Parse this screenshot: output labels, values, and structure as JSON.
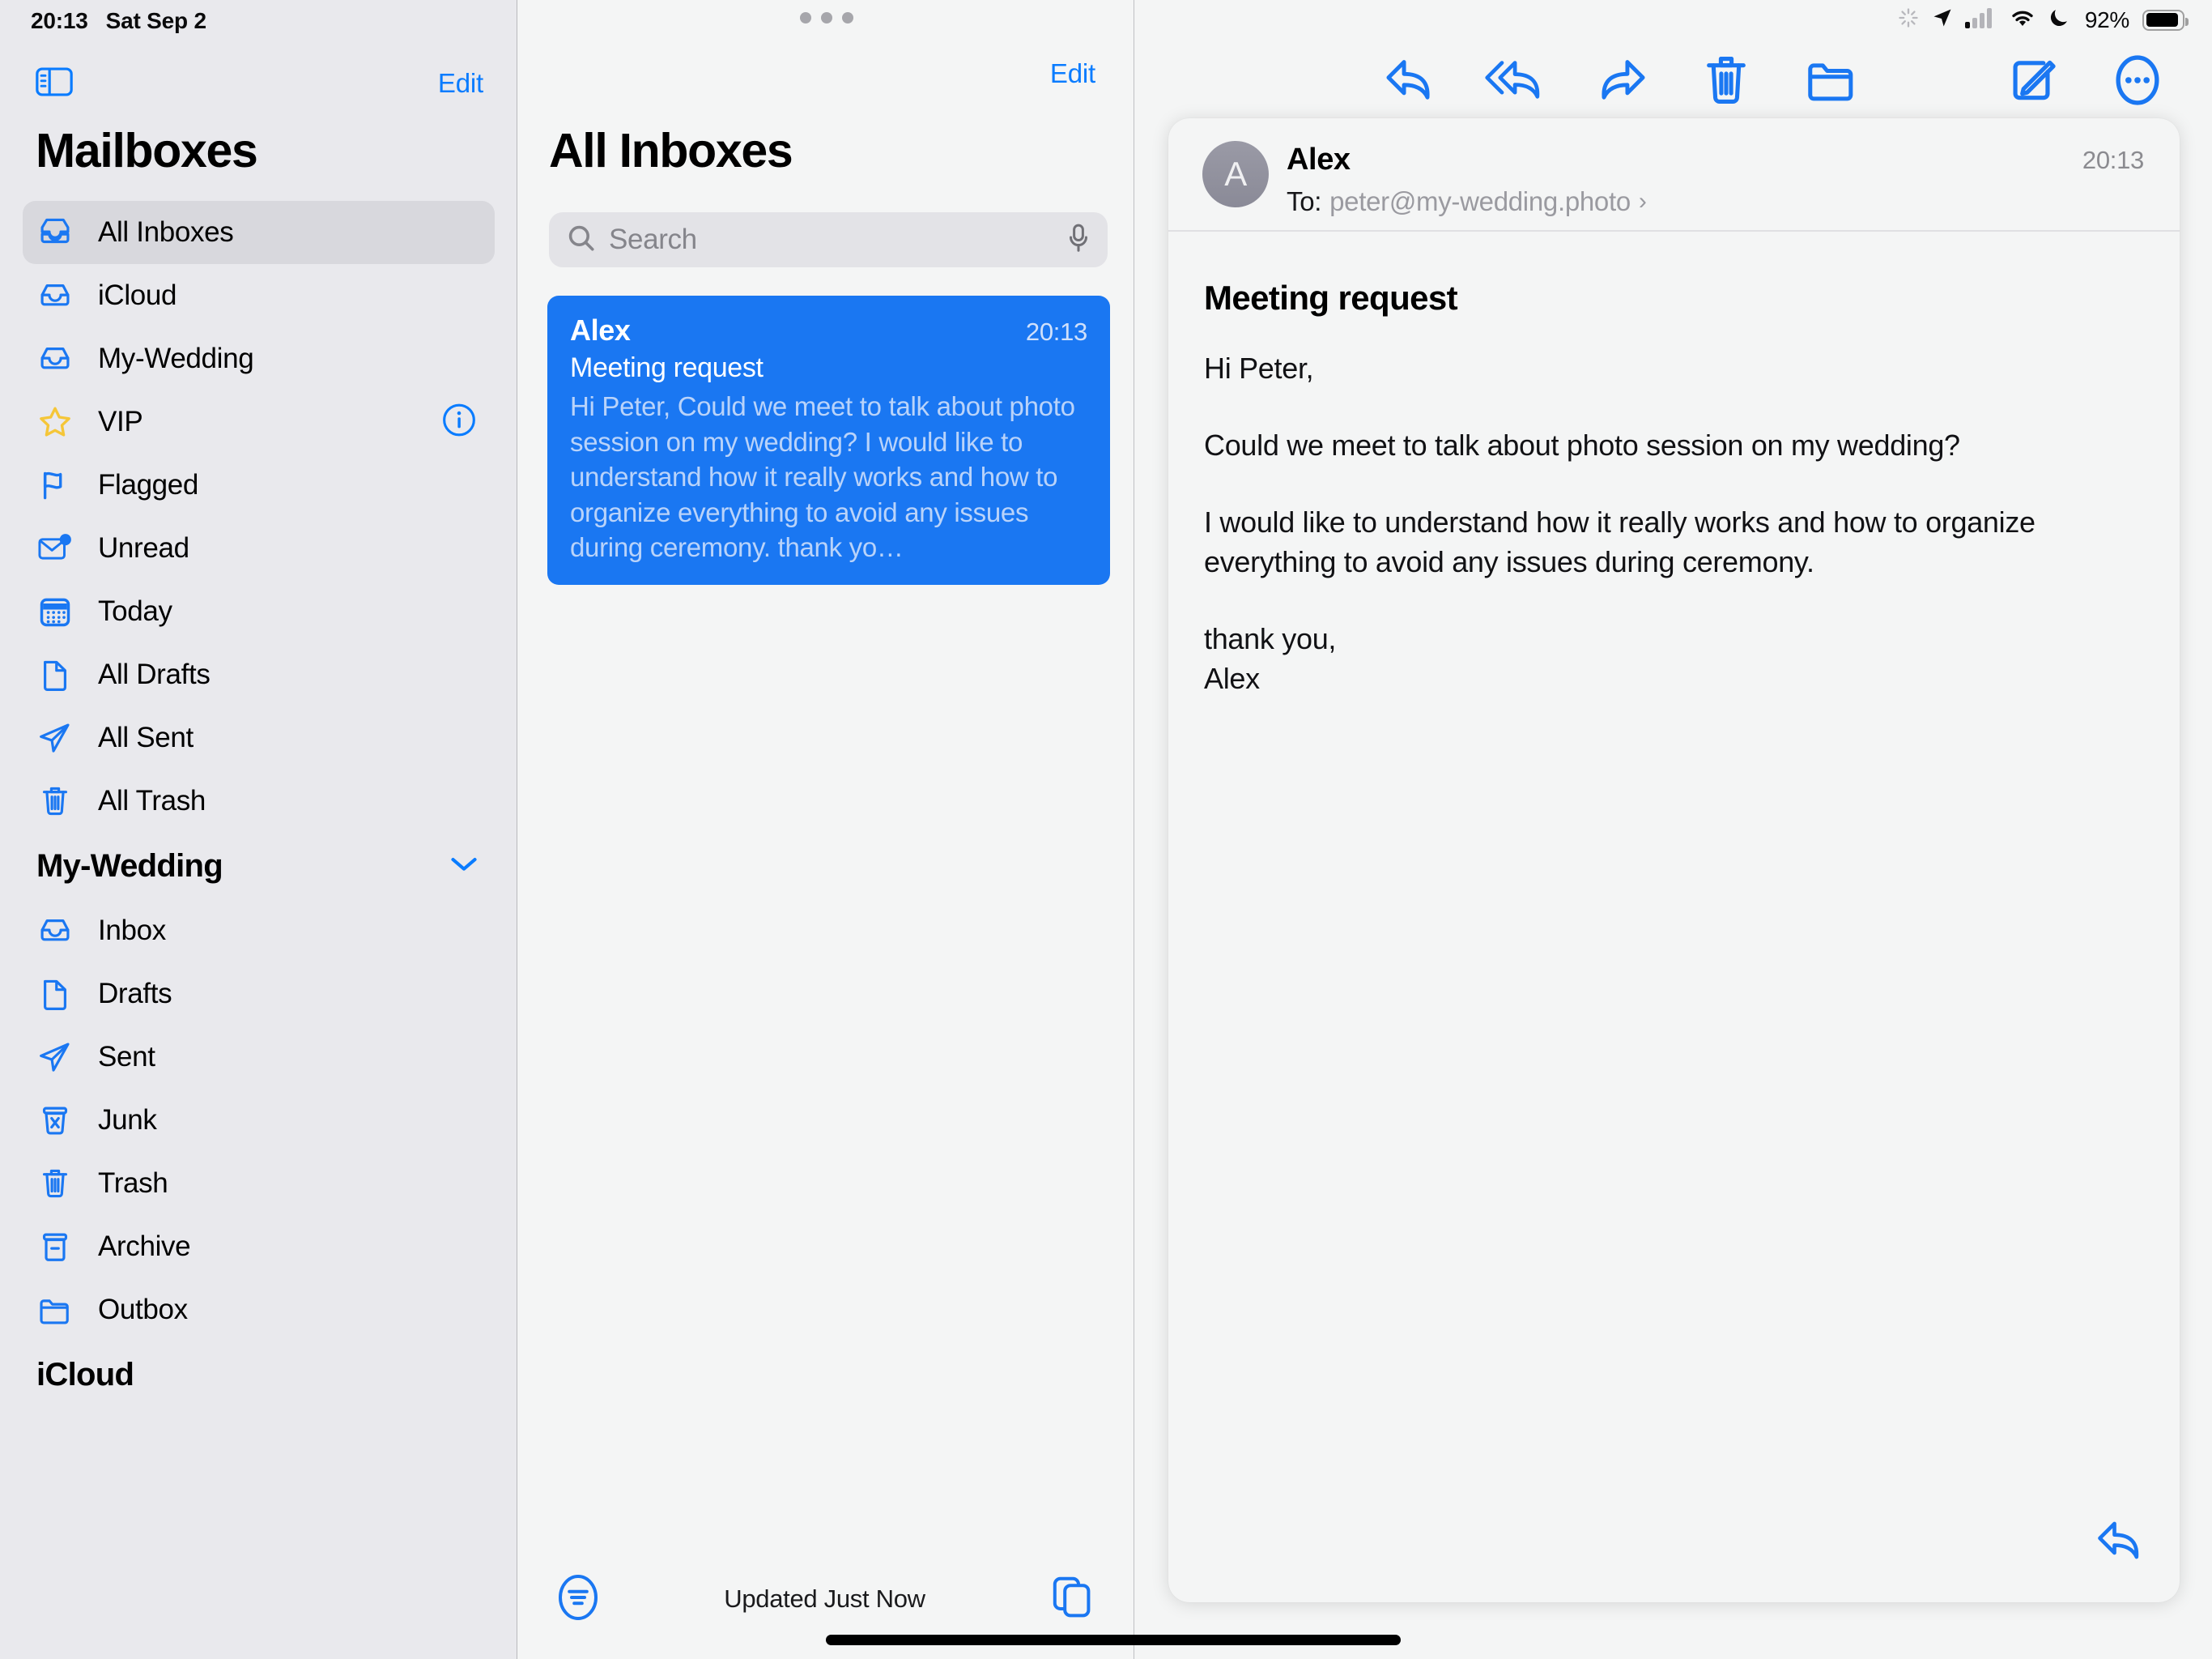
{
  "statusbar": {
    "time": "20:13",
    "date": "Sat Sep 2",
    "battery_percent": "92%",
    "icons": [
      "activity-spinner-icon",
      "location-arrow-icon",
      "cellular-signal-icon",
      "wifi-icon",
      "moon-do-not-disturb-icon",
      "battery-icon"
    ]
  },
  "sidebar": {
    "toggle_icon": "sidebar-toggle-icon",
    "edit_label": "Edit",
    "title": "Mailboxes",
    "items": [
      {
        "label": "All Inboxes",
        "icon": "inbox-stack-icon",
        "selected": true
      },
      {
        "label": "iCloud",
        "icon": "inbox-icon",
        "selected": false
      },
      {
        "label": "My-Wedding",
        "icon": "inbox-icon",
        "selected": false
      },
      {
        "label": "VIP",
        "icon": "star-icon",
        "selected": false,
        "trailing_icon": "info-circle-icon"
      },
      {
        "label": "Flagged",
        "icon": "flag-icon",
        "selected": false
      },
      {
        "label": "Unread",
        "icon": "unread-envelope-icon",
        "selected": false
      },
      {
        "label": "Today",
        "icon": "calendar-icon",
        "selected": false
      },
      {
        "label": "All Drafts",
        "icon": "document-icon",
        "selected": false
      },
      {
        "label": "All Sent",
        "icon": "paper-plane-icon",
        "selected": false
      },
      {
        "label": "All Trash",
        "icon": "trash-icon",
        "selected": false
      }
    ],
    "sections": [
      {
        "title": "My-Wedding",
        "chevron_icon": "chevron-down-icon",
        "items": [
          {
            "label": "Inbox",
            "icon": "inbox-icon"
          },
          {
            "label": "Drafts",
            "icon": "document-icon"
          },
          {
            "label": "Sent",
            "icon": "paper-plane-icon"
          },
          {
            "label": "Junk",
            "icon": "junk-bin-icon"
          },
          {
            "label": "Trash",
            "icon": "trash-icon"
          },
          {
            "label": "Archive",
            "icon": "archive-box-icon"
          },
          {
            "label": "Outbox",
            "icon": "folder-icon"
          }
        ]
      },
      {
        "title": "iCloud",
        "chevron_icon": "chevron-down-icon",
        "items": []
      }
    ]
  },
  "list_pane": {
    "edit_label": "Edit",
    "title": "All Inboxes",
    "search": {
      "placeholder": "Search",
      "icon": "search-icon",
      "mic_icon": "microphone-icon"
    },
    "messages": [
      {
        "sender": "Alex",
        "time": "20:13",
        "subject": "Meeting request",
        "preview": "Hi Peter, Could we meet to talk about photo session on my wedding? I would like to understand how it really works and how to organize everything to avoid any issues during ceremony. thank yo…",
        "selected": true
      }
    ],
    "bottom": {
      "filter_icon": "filter-lines-circle-icon",
      "status": "Updated Just Now",
      "compose_pages_icon": "duplicate-pages-icon"
    }
  },
  "detail_pane": {
    "toolbar": [
      {
        "name": "reply-button",
        "icon": "reply-arrow-icon"
      },
      {
        "name": "reply-all-button",
        "icon": "reply-all-arrow-icon"
      },
      {
        "name": "forward-button",
        "icon": "forward-arrow-icon"
      },
      {
        "name": "delete-button",
        "icon": "trash-icon"
      },
      {
        "name": "move-to-folder-button",
        "icon": "folder-icon"
      },
      {
        "name": "compose-button",
        "icon": "compose-pencil-icon"
      },
      {
        "name": "more-actions-button",
        "icon": "ellipsis-circle-icon"
      }
    ],
    "message": {
      "avatar_initial": "A",
      "sender": "Alex",
      "time": "20:13",
      "to_label": "To:",
      "to_address": "peter@my-wedding.photo",
      "to_chevron": "›",
      "subject": "Meeting request",
      "body_paragraphs": [
        "Hi Peter,",
        "Could we meet to talk about photo session on my wedding?",
        "I would like to understand how it really works and how to organize everything to avoid any issues during ceremony."
      ],
      "signature": "thank you,\nAlex"
    },
    "reply_icon": "reply-arrow-icon"
  },
  "colors": {
    "accent_blue": "#0a7cff",
    "selection_blue": "#1a77f2",
    "sidebar_bg": "#e9e9ed",
    "pane_bg": "#f4f5f5",
    "star_yellow": "#f5c638"
  }
}
